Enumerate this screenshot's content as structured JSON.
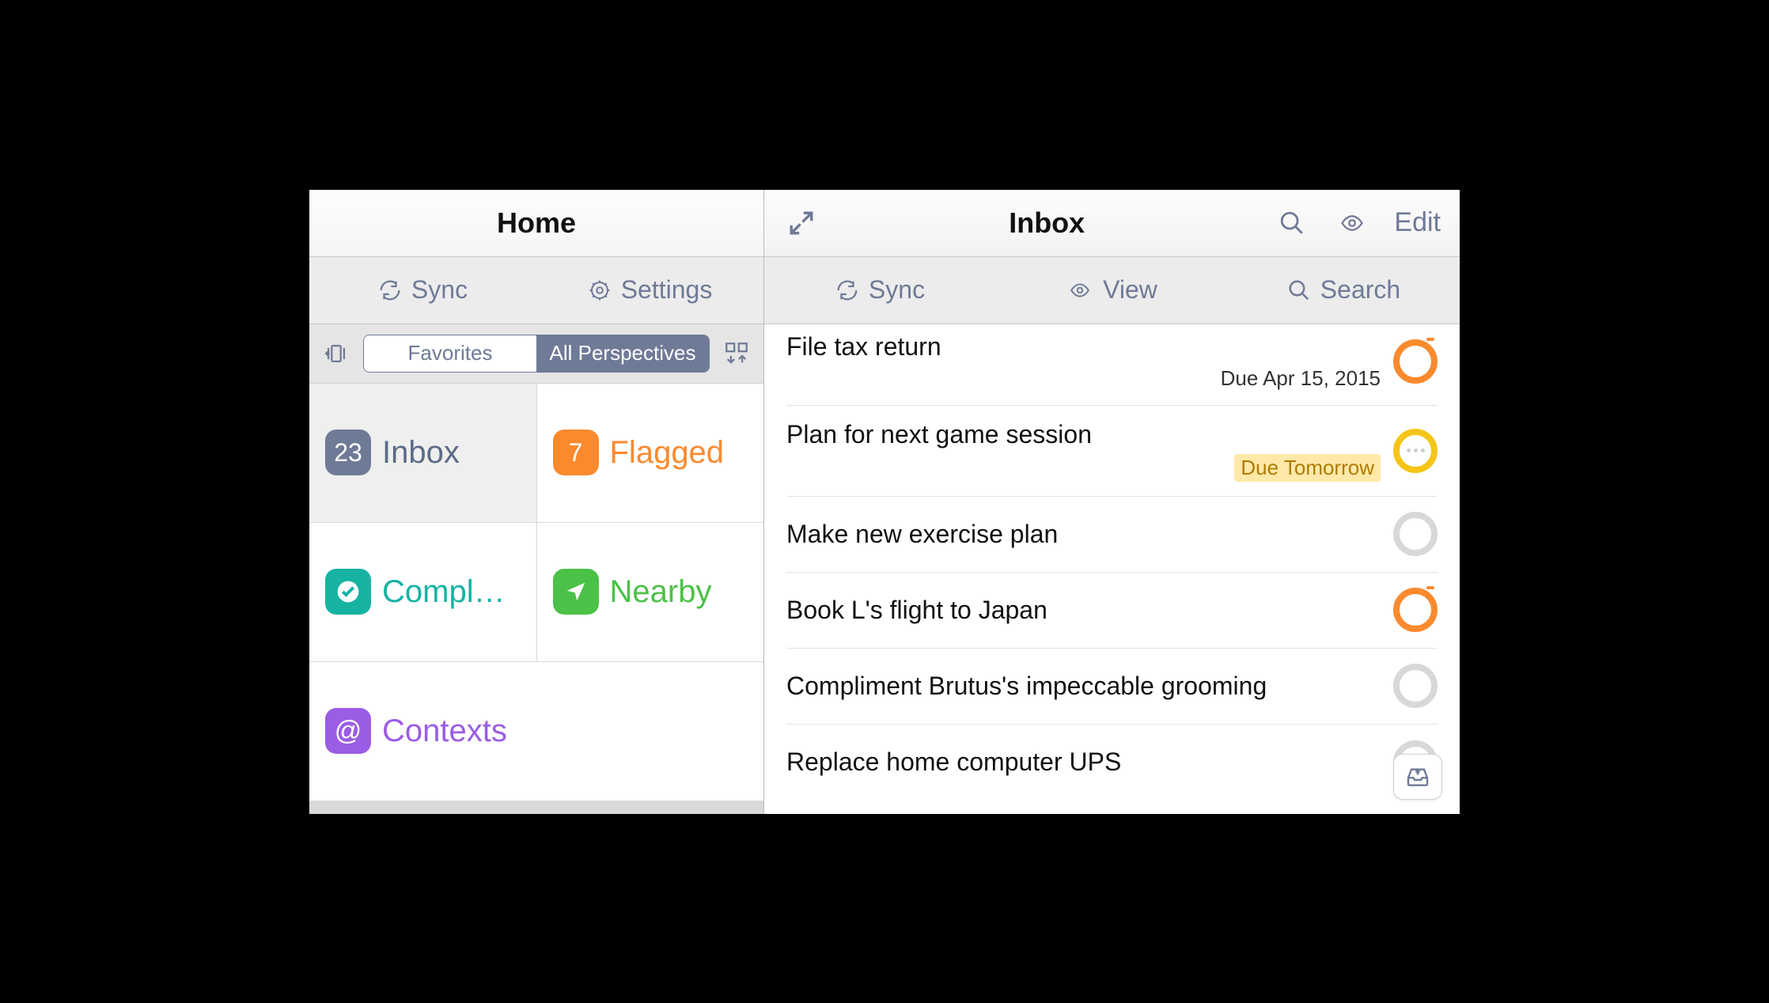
{
  "left": {
    "title": "Home",
    "actions": {
      "sync": "Sync",
      "settings": "Settings"
    },
    "segmented": {
      "favorites": "Favorites",
      "all": "All Perspectives",
      "active": "all"
    },
    "tiles": [
      {
        "badge": "23",
        "label": "Inbox",
        "color": "slate",
        "selected": true
      },
      {
        "badge": "7",
        "label": "Flagged",
        "color": "orange"
      },
      {
        "badge": "",
        "label": "Compl…",
        "color": "teal",
        "icon": "check"
      },
      {
        "badge": "",
        "label": "Nearby",
        "color": "green",
        "icon": "arrow"
      },
      {
        "badge": "",
        "label": "Contexts",
        "color": "purple",
        "icon": "at",
        "full": true
      }
    ]
  },
  "right": {
    "title": "Inbox",
    "edit": "Edit",
    "actions": {
      "sync": "Sync",
      "view": "View",
      "search": "Search"
    },
    "tasks": [
      {
        "title": "File tax return",
        "due": "Due Apr 15, 2015",
        "status": "orange"
      },
      {
        "title": "Plan for next game session",
        "due": "Due Tomorrow",
        "status": "yellow",
        "soon": true
      },
      {
        "title": "Make new exercise plan",
        "due": "",
        "status": "grey"
      },
      {
        "title": "Book L's flight to Japan",
        "due": "",
        "status": "orange"
      },
      {
        "title": "Compliment Brutus's impeccable grooming",
        "due": "",
        "status": "grey"
      },
      {
        "title": "Replace home computer UPS",
        "due": "",
        "status": "grey"
      }
    ]
  }
}
